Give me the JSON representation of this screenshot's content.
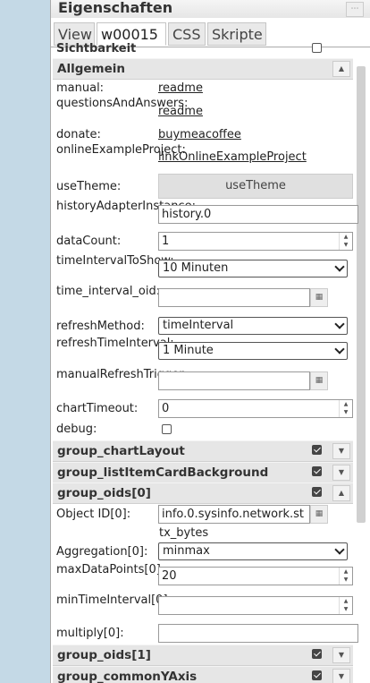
{
  "window": {
    "title": "Eigenschaften",
    "menu_icon": "grip-icon"
  },
  "tabs": [
    {
      "label": "View"
    },
    {
      "label": "w00015"
    },
    {
      "label": "CSS"
    },
    {
      "label": "Skripte"
    }
  ],
  "partial_row": {
    "label": "Sichtbarkeit"
  },
  "group_general": {
    "label": "Allgemein"
  },
  "fields": {
    "manual": {
      "label": "manual:",
      "value": "readme"
    },
    "qa": {
      "label": "questionsAndAnswers:",
      "value": "readme"
    },
    "donate": {
      "label": "donate:",
      "value": "buymeacoffee"
    },
    "online": {
      "label": "onlineExampleProject:",
      "value": "linkOnlineExampleProject"
    },
    "useTheme": {
      "label": "useTheme:",
      "value": "useTheme"
    },
    "historyAdapter": {
      "label": "historyAdapterInstance:",
      "value": "history.0"
    },
    "dataCount": {
      "label": "dataCount:",
      "value": "1"
    },
    "timeInterval": {
      "label": "timeIntervalToShow:",
      "value": "10 Minuten"
    },
    "timeIntervalOid": {
      "label": "time_interval_oid:",
      "value": ""
    },
    "refreshMethod": {
      "label": "refreshMethod:",
      "value": "timeInterval"
    },
    "refreshTimeInterval": {
      "label": "refreshTimeInterval:",
      "value": "1 Minute"
    },
    "manualRefresh": {
      "label": "manualRefreshTrigger:",
      "value": ""
    },
    "chartTimeout": {
      "label": "chartTimeout:",
      "value": "0"
    },
    "debug": {
      "label": "debug:",
      "checked": false
    }
  },
  "groups": {
    "chartLayout": {
      "label": "group_chartLayout",
      "checked": true
    },
    "listItemCard": {
      "label": "group_listItemCardBackground",
      "checked": true
    },
    "oids0": {
      "label": "group_oids[0]",
      "checked": true
    },
    "oids1": {
      "label": "group_oids[1]",
      "checked": true
    },
    "commonYAxis": {
      "label": "group_commonYAxis",
      "checked": true
    }
  },
  "oids0_fields": {
    "objectId": {
      "label": "Object ID[0]:",
      "value": "info.0.sysinfo.network.st",
      "sub": "tx_bytes"
    },
    "aggregation": {
      "label": "Aggregation[0]:",
      "value": "minmax"
    },
    "maxDataPoints": {
      "label": "maxDataPoints[0]:",
      "value": "20"
    },
    "minTimeInterval": {
      "label": "minTimeInterval[0]:",
      "value": ""
    },
    "multiply": {
      "label": "multiply[0]:",
      "value": ""
    }
  }
}
